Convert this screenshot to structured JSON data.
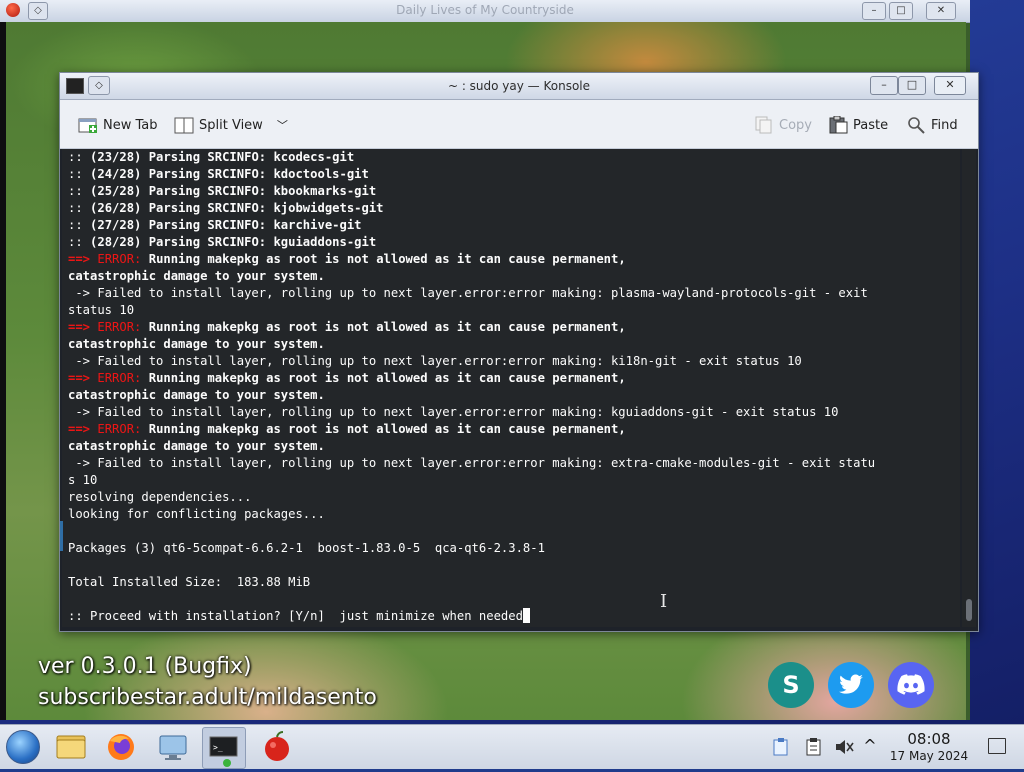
{
  "game": {
    "title": "Daily Lives of My Countryside",
    "version_text": "ver 0.3.0.1 (Bugfix)",
    "subscribe_text": "subscribestar.adult/mildasento",
    "social_icons": [
      "subscribestar-icon",
      "twitter-icon",
      "discord-icon"
    ]
  },
  "konsole": {
    "title": "~ : sudo yay — Konsole",
    "toolbar": {
      "new_tab": "New Tab",
      "split_view": "Split View",
      "copy": "Copy",
      "paste": "Paste",
      "find": "Find"
    },
    "terminal": {
      "lines": [
        {
          "pre": ":: ",
          "text": "(23/28) Parsing SRCINFO: kcodecs-git",
          "bold": true
        },
        {
          "pre": ":: ",
          "text": "(24/28) Parsing SRCINFO: kdoctools-git",
          "bold": true
        },
        {
          "pre": ":: ",
          "text": "(25/28) Parsing SRCINFO: kbookmarks-git",
          "bold": true
        },
        {
          "pre": ":: ",
          "text": "(26/28) Parsing SRCINFO: kjobwidgets-git",
          "bold": true
        },
        {
          "pre": ":: ",
          "text": "(27/28) Parsing SRCINFO: karchive-git",
          "bold": true
        },
        {
          "pre": ":: ",
          "text": "(28/28) Parsing SRCINFO: kguiaddons-git",
          "bold": true
        },
        {
          "err": true,
          "text": "Running makepkg as root is not allowed as it can cause permanent,"
        },
        {
          "text": "catastrophic damage to your system.",
          "bold": true
        },
        {
          "text": " -> Failed to install layer, rolling up to next layer.error:error making: plasma-wayland-protocols-git - exit"
        },
        {
          "text": "status 10"
        },
        {
          "err": true,
          "text": "Running makepkg as root is not allowed as it can cause permanent,"
        },
        {
          "text": "catastrophic damage to your system.",
          "bold": true
        },
        {
          "text": " -> Failed to install layer, rolling up to next layer.error:error making: ki18n-git - exit status 10"
        },
        {
          "err": true,
          "text": "Running makepkg as root is not allowed as it can cause permanent,"
        },
        {
          "text": "catastrophic damage to your system.",
          "bold": true
        },
        {
          "text": " -> Failed to install layer, rolling up to next layer.error:error making: kguiaddons-git - exit status 10"
        },
        {
          "err": true,
          "text": "Running makepkg as root is not allowed as it can cause permanent,"
        },
        {
          "text": "catastrophic damage to your system.",
          "bold": true
        },
        {
          "text": " -> Failed to install layer, rolling up to next layer.error:error making: extra-cmake-modules-git - exit statu"
        },
        {
          "text": "s 10"
        },
        {
          "text": "resolving dependencies..."
        },
        {
          "text": "looking for conflicting packages..."
        },
        {
          "text": ""
        },
        {
          "text": "Packages (3) qt6-5compat-6.6.2-1  boost-1.83.0-5  qca-qt6-2.3.8-1"
        },
        {
          "text": ""
        },
        {
          "text": "Total Installed Size:  183.88 MiB"
        },
        {
          "text": ""
        },
        {
          "text": ":: Proceed with installation? [Y/n]  just minimize when needed",
          "cursor": true
        }
      ],
      "error_arrow": "==>",
      "error_label": "ERROR:"
    }
  },
  "taskbar": {
    "clock_time": "08:08",
    "clock_date": "17 May 2024",
    "tray_arrow": "^"
  },
  "colors": {
    "terminal_bg": "#232629",
    "terminal_fg": "#fcfcfc",
    "error_red": "#ed1515",
    "titlebar": "#dfe6f0"
  }
}
